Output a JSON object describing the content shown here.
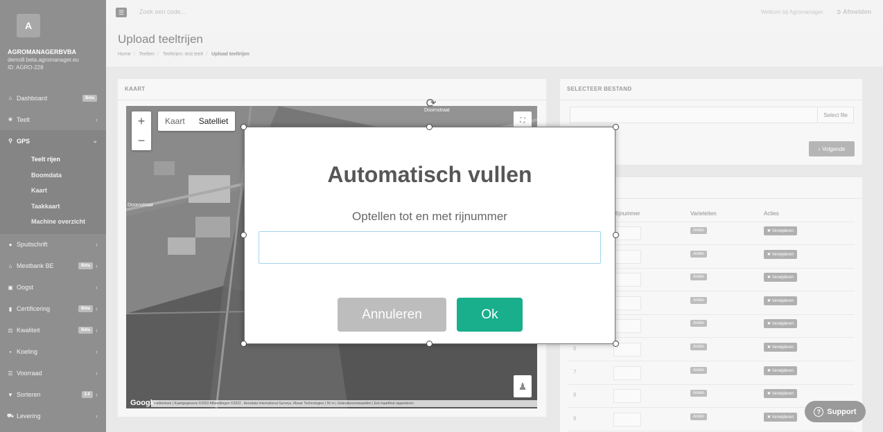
{
  "sidebar": {
    "avatar_letter": "A",
    "company": "AGROMANAGERBVBA",
    "domain": "demo8.beta.agromanager.eu",
    "org_id": "ID: AGRO-228",
    "items": [
      {
        "label": "Dashboard",
        "icon": "home-icon",
        "badge": "Beta"
      },
      {
        "label": "Teelt",
        "icon": "leaf-icon"
      },
      {
        "label": "GPS",
        "icon": "map-pin-icon"
      },
      {
        "label": "Spuitschrift",
        "icon": "drop-icon"
      },
      {
        "label": "Mestbank BE",
        "icon": "bank-icon",
        "badge": "Bèta"
      },
      {
        "label": "Oogst",
        "icon": "basket-icon"
      },
      {
        "label": "Certificering",
        "icon": "certificate-icon",
        "badge": "Bèta"
      },
      {
        "label": "Kwaliteit",
        "icon": "balance-icon",
        "badge": "Bèta"
      },
      {
        "label": "Koeling",
        "icon": "thermometer-icon"
      },
      {
        "label": "Voorraad",
        "icon": "list-icon"
      },
      {
        "label": "Sorteren",
        "icon": "filter-icon",
        "badge": "2.0"
      },
      {
        "label": "Levering",
        "icon": "truck-icon"
      }
    ],
    "gps_sub": [
      "Teelt rijen",
      "Boomdata",
      "Kaart",
      "Taakkaart",
      "Machine overzicht"
    ]
  },
  "topbar": {
    "search_placeholder": "Zoek een code...",
    "welcome": "Welkom bij Agromanager.",
    "logout": "Afmelden"
  },
  "page": {
    "title": "Upload teeltrijen",
    "crumbs": [
      "Home",
      "Teelten",
      "Teeltrijen: test teelt",
      "Upload teeltrijen"
    ]
  },
  "map_panel": {
    "title": "KAART",
    "zoom_in": "+",
    "zoom_out": "−",
    "map_type": "Kaart",
    "satellite": "Satelliet",
    "street1": "Doornstraat",
    "street2": "Doornstraat",
    "google": "Google",
    "attribution": "Sneltoetsen | Kaartgegevens ©2022 Afbeeldingen ©2022 , Aerodata International Surveys, Maxar Technologies | 50 m | Gebruiksvoorwaarden | Een kaartfout rapporteren"
  },
  "file_panel": {
    "title": "SELECTEER BESTAND",
    "select_file": "Select file",
    "next": "Volgende"
  },
  "table": {
    "headers": [
      "Rijnummer",
      "Varieteiten",
      "Acties"
    ],
    "rows": [
      {
        "num": "",
        "variety": "Areko",
        "action": "Verwijderen"
      },
      {
        "num": "",
        "variety": "Areko",
        "action": "Verwijderen"
      },
      {
        "num": "",
        "variety": "Areko",
        "action": "Verwijderen"
      },
      {
        "num": "",
        "variety": "Areko",
        "action": "Verwijderen"
      },
      {
        "num": "",
        "variety": "Areko",
        "action": "Verwijderen"
      },
      {
        "num": "6",
        "variety": "Areko",
        "action": "Verwijderen"
      },
      {
        "num": "7",
        "variety": "Areko",
        "action": "Verwijderen"
      },
      {
        "num": "8",
        "variety": "Areko",
        "action": "Verwijderen"
      },
      {
        "num": "9",
        "variety": "Areko",
        "action": "Verwijderen"
      }
    ]
  },
  "support": "Support",
  "modal": {
    "title": "Automatisch vullen",
    "label": "Optellen tot en met rijnummer",
    "input_value": "",
    "cancel": "Annuleren",
    "ok": "Ok"
  },
  "colors": {
    "ok_button": "#19ae8c",
    "sidebar": "#8f8f8f"
  }
}
